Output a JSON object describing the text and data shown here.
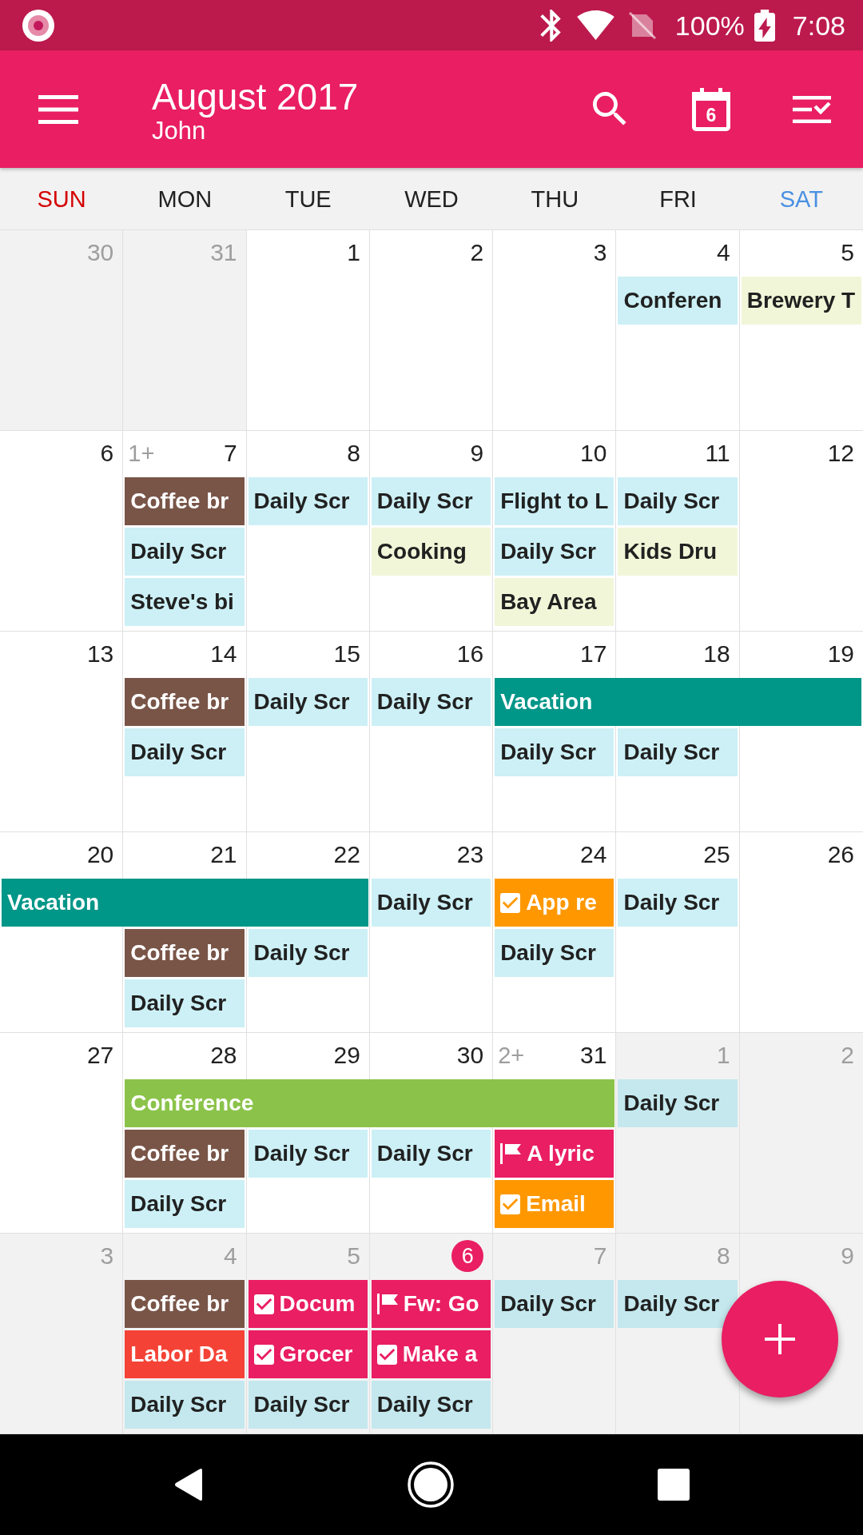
{
  "status_bar": {
    "battery": "100%",
    "time": "7:08"
  },
  "app_bar": {
    "title": "August 2017",
    "subtitle": "John",
    "today_date": "6"
  },
  "weekdays": [
    {
      "label": "SUN",
      "color": "#d50000"
    },
    {
      "label": "MON",
      "color": "#212121"
    },
    {
      "label": "TUE",
      "color": "#212121"
    },
    {
      "label": "WED",
      "color": "#212121"
    },
    {
      "label": "THU",
      "color": "#212121"
    },
    {
      "label": "FRI",
      "color": "#212121"
    },
    {
      "label": "SAT",
      "color": "#4a90e2"
    }
  ],
  "weeks": [
    {
      "days": [
        {
          "day": "30",
          "in_month": false,
          "today": false
        },
        {
          "day": "31",
          "in_month": false,
          "today": false
        },
        {
          "day": "1",
          "in_month": true,
          "today": false
        },
        {
          "day": "2",
          "in_month": true,
          "today": false
        },
        {
          "day": "3",
          "in_month": true,
          "today": false
        },
        {
          "day": "4",
          "in_month": true,
          "today": false,
          "events": [
            {
              "kind": "event",
              "title": "Conferen",
              "color": "#ccf0f6"
            }
          ]
        },
        {
          "day": "5",
          "in_month": true,
          "today": false,
          "events": [
            {
              "kind": "event",
              "title": "Brewery T",
              "color": "#f1f6d8"
            }
          ]
        }
      ]
    },
    {
      "days": [
        {
          "day": "6",
          "in_month": true,
          "today": false
        },
        {
          "day": "7",
          "in_month": true,
          "today": false,
          "more": "1+",
          "events": [
            {
              "kind": "event",
              "title": "Coffee br",
              "color": "#795548"
            },
            {
              "kind": "event",
              "title": "Daily Scr",
              "color": "#ccf0f6"
            },
            {
              "kind": "event",
              "title": "Steve's bi",
              "color": "#ccf0f6"
            }
          ]
        },
        {
          "day": "8",
          "in_month": true,
          "today": false,
          "events": [
            {
              "kind": "event",
              "title": "Daily Scr",
              "color": "#ccf0f6"
            }
          ]
        },
        {
          "day": "9",
          "in_month": true,
          "today": false,
          "events": [
            {
              "kind": "event",
              "title": "Daily Scr",
              "color": "#ccf0f6"
            },
            {
              "kind": "event",
              "title": "Cooking",
              "color": "#f1f6d8"
            }
          ]
        },
        {
          "day": "10",
          "in_month": true,
          "today": false,
          "events": [
            {
              "kind": "event",
              "title": "Flight to L",
              "color": "#ccf0f6"
            },
            {
              "kind": "event",
              "title": "Daily Scr",
              "color": "#ccf0f6"
            },
            {
              "kind": "event",
              "title": "Bay Area",
              "color": "#f1f6d8"
            }
          ]
        },
        {
          "day": "11",
          "in_month": true,
          "today": false,
          "events": [
            {
              "kind": "event",
              "title": "Daily Scr",
              "color": "#ccf0f6"
            },
            {
              "kind": "event",
              "title": "Kids Dru",
              "color": "#f1f6d8"
            }
          ]
        },
        {
          "day": "12",
          "in_month": true,
          "today": false
        }
      ]
    },
    {
      "days": [
        {
          "day": "13",
          "in_month": true,
          "today": false
        },
        {
          "day": "14",
          "in_month": true,
          "today": false,
          "events": [
            {
              "kind": "event",
              "title": "Coffee br",
              "color": "#795548"
            },
            {
              "kind": "event",
              "title": "Daily Scr",
              "color": "#ccf0f6"
            }
          ]
        },
        {
          "day": "15",
          "in_month": true,
          "today": false,
          "events": [
            {
              "kind": "event",
              "title": "Daily Scr",
              "color": "#ccf0f6"
            }
          ]
        },
        {
          "day": "16",
          "in_month": true,
          "today": false,
          "events": [
            {
              "kind": "event",
              "title": "Daily Scr",
              "color": "#ccf0f6"
            }
          ]
        },
        {
          "day": "17",
          "in_month": true,
          "today": false,
          "events": [
            {
              "kind": "event",
              "title": "Vacation",
              "color": "#009688"
            },
            {
              "kind": "event",
              "title": "Daily Scr",
              "color": "#ccf0f6"
            }
          ]
        },
        {
          "day": "18",
          "in_month": true,
          "today": false,
          "events": [
            {
              "kind": "continued"
            },
            {
              "kind": "event",
              "title": "Daily Scr",
              "color": "#ccf0f6"
            }
          ]
        },
        {
          "day": "19",
          "in_month": true,
          "today": false,
          "events": [
            {
              "kind": "continued"
            }
          ]
        }
      ]
    },
    {
      "days": [
        {
          "day": "20",
          "in_month": true,
          "today": false,
          "events": [
            {
              "kind": "event",
              "title": "Vacation",
              "color": "#009688"
            }
          ]
        },
        {
          "day": "21",
          "in_month": true,
          "today": false,
          "events": [
            {
              "kind": "continued"
            },
            {
              "kind": "event",
              "title": "Coffee br",
              "color": "#795548"
            },
            {
              "kind": "event",
              "title": "Daily Scr",
              "color": "#ccf0f6"
            }
          ]
        },
        {
          "day": "22",
          "in_month": true,
          "today": false,
          "events": [
            {
              "kind": "continued"
            },
            {
              "kind": "event",
              "title": "Daily Scr",
              "color": "#ccf0f6"
            }
          ]
        },
        {
          "day": "23",
          "in_month": true,
          "today": false,
          "events": [
            {
              "kind": "event",
              "title": "Daily Scr",
              "color": "#ccf0f6"
            }
          ]
        },
        {
          "day": "24",
          "in_month": true,
          "today": false,
          "events": [
            {
              "kind": "task",
              "title": "App re",
              "color": "#ff9800",
              "checked": true
            },
            {
              "kind": "event",
              "title": "Daily Scr",
              "color": "#ccf0f6"
            }
          ]
        },
        {
          "day": "25",
          "in_month": true,
          "today": false,
          "events": [
            {
              "kind": "event",
              "title": "Daily Scr",
              "color": "#ccf0f6"
            }
          ]
        },
        {
          "day": "26",
          "in_month": true,
          "today": false
        }
      ]
    },
    {
      "days": [
        {
          "day": "27",
          "in_month": true,
          "today": false
        },
        {
          "day": "28",
          "in_month": true,
          "today": false,
          "events": [
            {
              "kind": "event",
              "title": "Conference",
              "color": "#8bc34a"
            },
            {
              "kind": "event",
              "title": "Coffee br",
              "color": "#795548"
            },
            {
              "kind": "event",
              "title": "Daily Scr",
              "color": "#ccf0f6"
            }
          ]
        },
        {
          "day": "29",
          "in_month": true,
          "today": false,
          "events": [
            {
              "kind": "continued"
            },
            {
              "kind": "event",
              "title": "Daily Scr",
              "color": "#ccf0f6"
            }
          ]
        },
        {
          "day": "30",
          "in_month": true,
          "today": false,
          "events": [
            {
              "kind": "continued"
            },
            {
              "kind": "event",
              "title": "Daily Scr",
              "color": "#ccf0f6"
            }
          ]
        },
        {
          "day": "31",
          "in_month": true,
          "today": false,
          "more": "2+",
          "events": [
            {
              "kind": "continued"
            },
            {
              "kind": "flag",
              "title": "A lyric",
              "color": "#e91e63"
            },
            {
              "kind": "task",
              "title": "Email",
              "color": "#ff9800",
              "checked": true
            }
          ]
        },
        {
          "day": "1",
          "in_month": false,
          "today": false,
          "events": [
            {
              "kind": "event",
              "title": "Daily Scr",
              "color": "#c4e8ee"
            }
          ]
        },
        {
          "day": "2",
          "in_month": false,
          "today": false
        }
      ]
    },
    {
      "days": [
        {
          "day": "3",
          "in_month": false,
          "today": false
        },
        {
          "day": "4",
          "in_month": false,
          "today": false,
          "events": [
            {
              "kind": "event",
              "title": "Coffee br",
              "color": "#795548"
            },
            {
              "kind": "event",
              "title": "Labor Da",
              "color": "#f44336"
            },
            {
              "kind": "event",
              "title": "Daily Scr",
              "color": "#c4e8ee"
            }
          ]
        },
        {
          "day": "5",
          "in_month": false,
          "today": false,
          "events": [
            {
              "kind": "task",
              "title": "Docum",
              "color": "#e91e63",
              "checked": true
            },
            {
              "kind": "task",
              "title": "Grocer",
              "color": "#e91e63",
              "checked": true
            },
            {
              "kind": "event",
              "title": "Daily Scr",
              "color": "#c4e8ee"
            }
          ]
        },
        {
          "day": "6",
          "in_month": false,
          "today": true,
          "events": [
            {
              "kind": "flag",
              "title": "Fw: Go",
              "color": "#e91e63"
            },
            {
              "kind": "task",
              "title": "Make a",
              "color": "#e91e63",
              "checked": true
            },
            {
              "kind": "event",
              "title": "Daily Scr",
              "color": "#c4e8ee"
            }
          ]
        },
        {
          "day": "7",
          "in_month": false,
          "today": false,
          "events": [
            {
              "kind": "event",
              "title": "Daily Scr",
              "color": "#c4e8ee"
            }
          ]
        },
        {
          "day": "8",
          "in_month": false,
          "today": false,
          "events": [
            {
              "kind": "event",
              "title": "Daily Scr",
              "color": "#c4e8ee"
            }
          ]
        },
        {
          "day": "9",
          "in_month": false,
          "today": false
        }
      ]
    }
  ]
}
